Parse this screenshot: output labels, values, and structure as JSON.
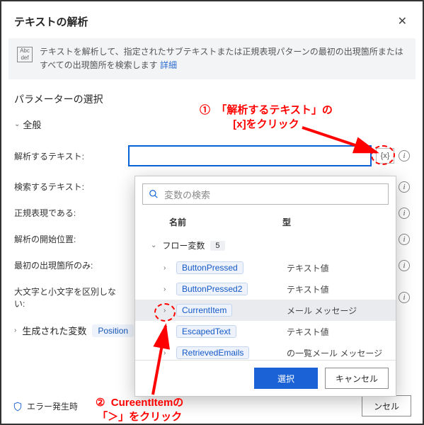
{
  "dialog": {
    "title": "テキストの解析",
    "infoIcon": {
      "line1": "Abc",
      "line2": "def"
    },
    "infoText": "テキストを解析して、指定されたサブテキストまたは正規表現パターンの最初の出現箇所またはすべての出現箇所を検索します ",
    "detailsLink": "詳細",
    "sectionTitle": "パラメーターの選択",
    "general": "全般",
    "params": {
      "parseText": "解析するテキスト:",
      "searchText": "検索するテキスト:",
      "isRegex": "正規表現である:",
      "startPos": "解析の開始位置:",
      "firstOnly": "最初の出現箇所のみ:",
      "caseSensitive": "大文字と小文字を区別しない:"
    },
    "varToken": "{x}",
    "generated": {
      "label": "生成された変数",
      "badge": "Position"
    },
    "error": "エラー発生時",
    "cancel": "ンセル"
  },
  "picker": {
    "searchPlaceholder": "変数の検索",
    "colName": "名前",
    "colType": "型",
    "group": "フロー変数",
    "count": "5",
    "items": [
      {
        "name": "ButtonPressed",
        "type": "テキスト値"
      },
      {
        "name": "ButtonPressed2",
        "type": "テキスト値"
      },
      {
        "name": "CurrentItem",
        "type": "メール メッセージ"
      },
      {
        "name": "EscapedText",
        "type": "テキスト値"
      },
      {
        "name": "RetrievedEmails",
        "type": "の一覧メール メッセージ"
      }
    ],
    "select": "選択",
    "cancel": "キャンセル"
  },
  "annotation": {
    "a1": "①  「解析するテキスト」の\n[x]をクリック",
    "a2": "②  CureentItemの\n「＞」をクリック"
  }
}
